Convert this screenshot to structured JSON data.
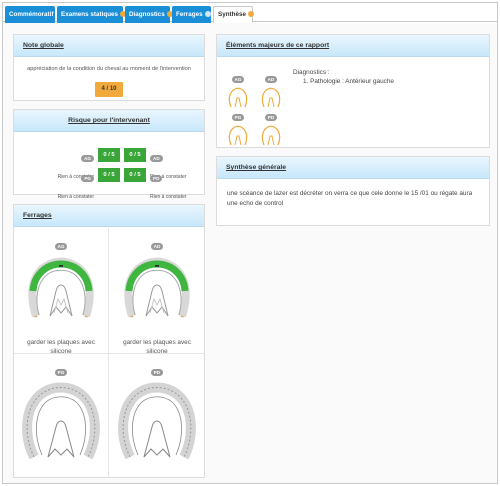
{
  "tabs": [
    {
      "label": "Commémoratif",
      "badge": null
    },
    {
      "label": "Examens statiques",
      "badge": "orange"
    },
    {
      "label": "Diagnostics",
      "badge": "orange"
    },
    {
      "label": "Ferrages",
      "badge": "blue"
    },
    {
      "label": "Synthèse",
      "badge": "orange"
    }
  ],
  "note_globale": {
    "title": "Note globale",
    "description": "appréciation de la condition du cheval au moment de l'intervention",
    "score": "4 / 10",
    "score_color": "#f2a93b"
  },
  "risque": {
    "title": "Risque pour l'intervenant",
    "left": [
      {
        "tag": "AG",
        "label": "Rien à constater",
        "score": "0 / 5"
      },
      {
        "tag": "PG",
        "label": "Rien à constater",
        "score": "0 / 5"
      }
    ],
    "right": [
      {
        "tag": "AD",
        "label": "Rien à constater",
        "score": "0 / 5"
      },
      {
        "tag": "PD",
        "label": "Rien à constater",
        "score": "0 / 5"
      }
    ],
    "score_color": "#3aa63a"
  },
  "ferrages": {
    "title": "Ferrages",
    "cells": [
      {
        "tag": "AG",
        "note": "garder les plaques avec silicone"
      },
      {
        "tag": "AD",
        "note": "garder les plaques avec silicone"
      },
      {
        "tag": "PG",
        "note": ""
      },
      {
        "tag": "PD",
        "note": ""
      }
    ]
  },
  "elements": {
    "title": "Éléments majeurs de ce rapport",
    "hooves": [
      "AG",
      "AD",
      "PG",
      "PD"
    ],
    "diag_heading": "Diagnostics :",
    "diag_items": [
      "1. Pathologie : Antérieur gauche"
    ]
  },
  "synthese": {
    "title": "Synthèse générale",
    "text": "une scéance de lazer est décréter on verra ce que cele donne le 15 /01 ou régate aura une echo de control"
  },
  "colors": {
    "accent": "#1a8fd8",
    "green": "#3aa63a",
    "orange": "#f2a93b",
    "hoof_gray": "#bdbdbd"
  }
}
